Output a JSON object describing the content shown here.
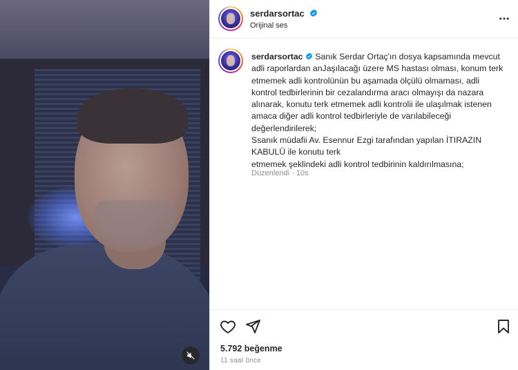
{
  "post": {
    "username": "serdarsortac",
    "audio_label": "Orijinal ses",
    "caption_lines": [
      "Sanık Serdar Ortaç'ın dosya kapsamında mevcut",
      "adli raporlardan anJaşılacağı üzere MS hastası olması, konum terk",
      "etmemek adli kontrolünün bu aşamada ölçülü olmaması, adli",
      "kontrol tedbirlerinin bir cezalandırma aracı olmayışı da nazara",
      "alınarak, konutu terk etmemek adli kontrolii ile ulaşılmak istenen",
      "amaca diğer adli kontrol tedbirleriyle de varılabileceği",
      "değerlendirilerek;",
      "Ssanık müdafii Av. Esennur Ezgi tarafından yapılan İTIRAZIN",
      "KABULÜ ile konutu terk",
      "etmemek şeklindeki adli kontrol tedbirinin kaldırılmasına;"
    ],
    "edited_label": "Düzenlendi · 10s",
    "likes_label": "5.792 beğenme",
    "time_ago": "11 saat önce"
  },
  "icons": {
    "verified": "verified-badge-icon",
    "more": "more-options-icon",
    "like": "heart-icon",
    "share": "send-icon",
    "save": "bookmark-icon",
    "mute": "muted-speaker-icon"
  },
  "colors": {
    "verified": "#0095f6",
    "text": "#262626",
    "muted_text": "#8e8e8e",
    "divider": "#efefef"
  }
}
